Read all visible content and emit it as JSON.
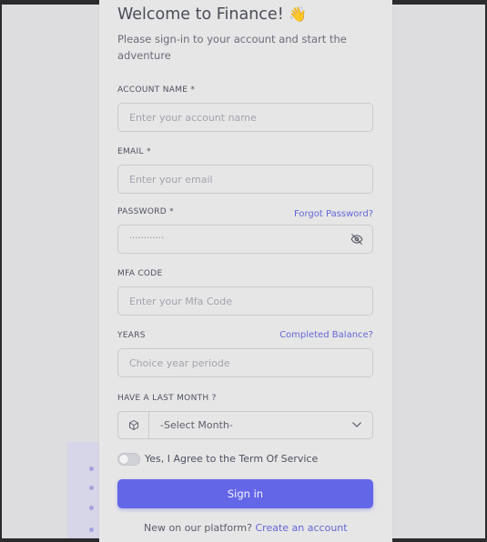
{
  "header": {
    "title": "Welcome to Finance!",
    "wave_emoji": "👋",
    "subtitle": "Please sign-in to your account and start the adventure"
  },
  "form": {
    "account_name": {
      "label": "ACCOUNT NAME *",
      "placeholder": "Enter your account name"
    },
    "email": {
      "label": "EMAIL *",
      "placeholder": "Enter your email"
    },
    "password": {
      "label": "PASSWORD *",
      "masked_value": "············",
      "forgot_link": "Forgot Password?",
      "toggle_icon": "eye-slash-icon"
    },
    "mfa": {
      "label": "MFA CODE",
      "placeholder": "Enter your Mfa Code"
    },
    "years": {
      "label": "YEARS",
      "placeholder": "Choice year periode",
      "link": "Completed Balance?"
    },
    "month": {
      "label": "HAVE A LAST MONTH ?",
      "selected": "-Select Month-",
      "addon_icon": "cube-icon",
      "arrow_icon": "chevron-down-icon"
    },
    "terms": {
      "label": "Yes, I Agree to the Term Of Service",
      "checked": false
    },
    "submit_label": "Sign in"
  },
  "footer": {
    "prompt": "New on our platform?",
    "create_link": "Create an account"
  },
  "colors": {
    "accent": "#6466e8",
    "link": "#6366d6",
    "card": "#e6e6e6",
    "page": "#dddde0"
  }
}
